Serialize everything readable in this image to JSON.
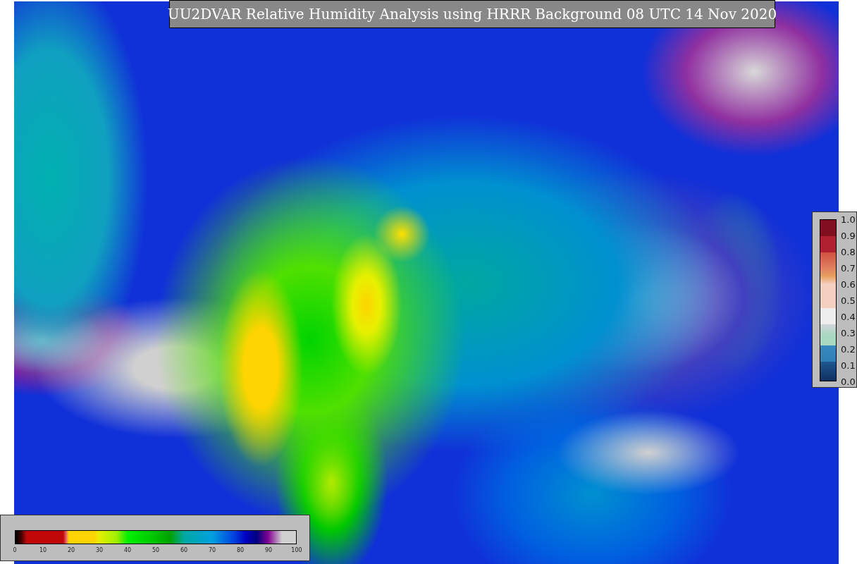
{
  "title": "UU2DVAR Relative Humidity Analysis using HRRR Background 08 UTC 14 Nov 2020",
  "humidity_colorbar": {
    "ticks": [
      "0",
      "10",
      "20",
      "30",
      "40",
      "50",
      "60",
      "70",
      "80",
      "90",
      "100"
    ]
  },
  "fraction_colorbar": {
    "ticks": [
      "1.0",
      "0.9",
      "0.8",
      "0.7",
      "0.6",
      "0.5",
      "0.4",
      "0.3",
      "0.2",
      "0.1",
      "0.0"
    ]
  }
}
